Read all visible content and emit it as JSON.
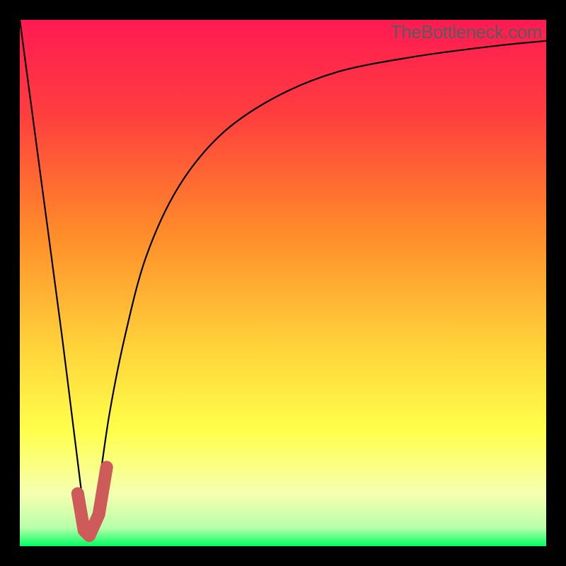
{
  "watermark": "TheBottleneck.com",
  "colors": {
    "frame": "#000000",
    "curve_stroke": "#000000",
    "marker_stroke": "#cf5a5a",
    "gradient_stops": [
      {
        "offset": 0.0,
        "color": "#ff1a53"
      },
      {
        "offset": 0.18,
        "color": "#ff3e3e"
      },
      {
        "offset": 0.4,
        "color": "#ff8a2a"
      },
      {
        "offset": 0.62,
        "color": "#ffd23a"
      },
      {
        "offset": 0.78,
        "color": "#ffff4a"
      },
      {
        "offset": 0.9,
        "color": "#f6ffb0"
      },
      {
        "offset": 0.965,
        "color": "#b8ffaa"
      },
      {
        "offset": 1.0,
        "color": "#00ff62"
      }
    ]
  },
  "chart_data": {
    "type": "line",
    "title": "",
    "xlabel": "",
    "ylabel": "",
    "xlim": [
      0,
      100
    ],
    "ylim": [
      0,
      100
    ],
    "series": [
      {
        "name": "bottleneck-curve",
        "x": [
          0,
          4,
          8,
          11.5,
          13,
          14.5,
          17,
          20,
          24,
          30,
          38,
          48,
          60,
          75,
          90,
          100
        ],
        "values": [
          100,
          70,
          40,
          12,
          2,
          8,
          25,
          40,
          55,
          68,
          78,
          85,
          90,
          93,
          95,
          96
        ]
      }
    ],
    "marker": {
      "name": "recommended-region",
      "path_xy": [
        [
          11.0,
          10.0
        ],
        [
          12.2,
          3.0
        ],
        [
          13.2,
          2.0
        ],
        [
          15.0,
          6.0
        ],
        [
          16.5,
          15.0
        ]
      ]
    }
  }
}
